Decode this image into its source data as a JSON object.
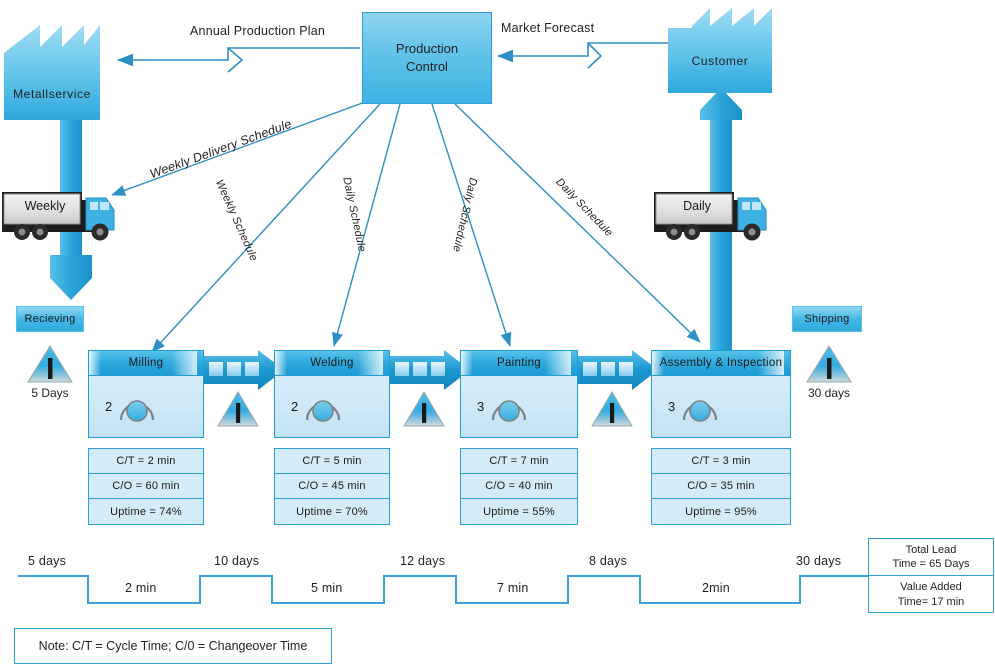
{
  "title": "Value Stream Map",
  "colors": {
    "accent": "#2e9fd4",
    "process_header": "#1d9bd4",
    "process_body": "#cfe9f7",
    "data_box": "#d4ecf8",
    "material_arrow": "#2ba4da",
    "text": "#231f20"
  },
  "supplier": {
    "label": "Metallservice"
  },
  "customer": {
    "label": "Customer"
  },
  "production_control": {
    "label": "Production\nControl",
    "line1": "Production",
    "line2": "Control"
  },
  "information_flows": [
    {
      "name": "annual-production-plan",
      "label": "Annual Production Plan"
    },
    {
      "name": "market-forecast",
      "label": "Market Forecast"
    },
    {
      "name": "weekly-delivery-schedule",
      "label": "Weekly Delivery Schedule"
    },
    {
      "name": "weekly-schedule",
      "label": "Weekly Schedule"
    },
    {
      "name": "daily-schedule-welding",
      "label": "Daily Schedule"
    },
    {
      "name": "daily-schedule-painting",
      "label": "Daily Schedule"
    },
    {
      "name": "daily-schedule-assembly",
      "label": "Daily Schedule"
    }
  ],
  "trucks": [
    {
      "name": "inbound-truck",
      "label": "Weekly"
    },
    {
      "name": "outbound-truck",
      "label": "Daily"
    }
  ],
  "plates": [
    {
      "name": "receiving-plate",
      "label": "Recieving"
    },
    {
      "name": "shipping-plate",
      "label": "Shipping"
    }
  ],
  "inventories": [
    {
      "name": "inventory-receiving",
      "label": "5 Days"
    },
    {
      "name": "inventory-milling-welding",
      "label": ""
    },
    {
      "name": "inventory-welding-painting",
      "label": ""
    },
    {
      "name": "inventory-painting-assembly",
      "label": ""
    },
    {
      "name": "inventory-shipping",
      "label": "30 days"
    }
  ],
  "processes": [
    {
      "name": "milling",
      "title": "Milling",
      "operators": "2",
      "data": [
        "C/T = 2 min",
        "C/O = 60 min",
        "Uptime = 74%"
      ]
    },
    {
      "name": "welding",
      "title": "Welding",
      "operators": "2",
      "data": [
        "C/T = 5 min",
        "C/O = 45 min",
        "Uptime = 70%"
      ]
    },
    {
      "name": "painting",
      "title": "Painting",
      "operators": "3",
      "data": [
        "C/T = 7 min",
        "C/O = 40 min",
        "Uptime = 55%"
      ]
    },
    {
      "name": "assembly-inspection",
      "title": "Assembly & Inspection",
      "operators": "3",
      "data": [
        "C/T = 3 min",
        "C/O = 35 min",
        "Uptime = 95%"
      ]
    }
  ],
  "timeline": {
    "lead_times": [
      "5 days",
      "10 days",
      "12 days",
      "8 days",
      "30 days"
    ],
    "process_times": [
      "2 min",
      "5 min",
      "7 min",
      "2min"
    ]
  },
  "summary": {
    "total_lead_line1": "Total Lead",
    "total_lead_line2": "Time = 65 Days",
    "value_added_line1": "Value Added",
    "value_added_line2": "Time= 17 min"
  },
  "note": {
    "text": "Note: C/T = Cycle Time; C/0 = Changeover Time"
  }
}
